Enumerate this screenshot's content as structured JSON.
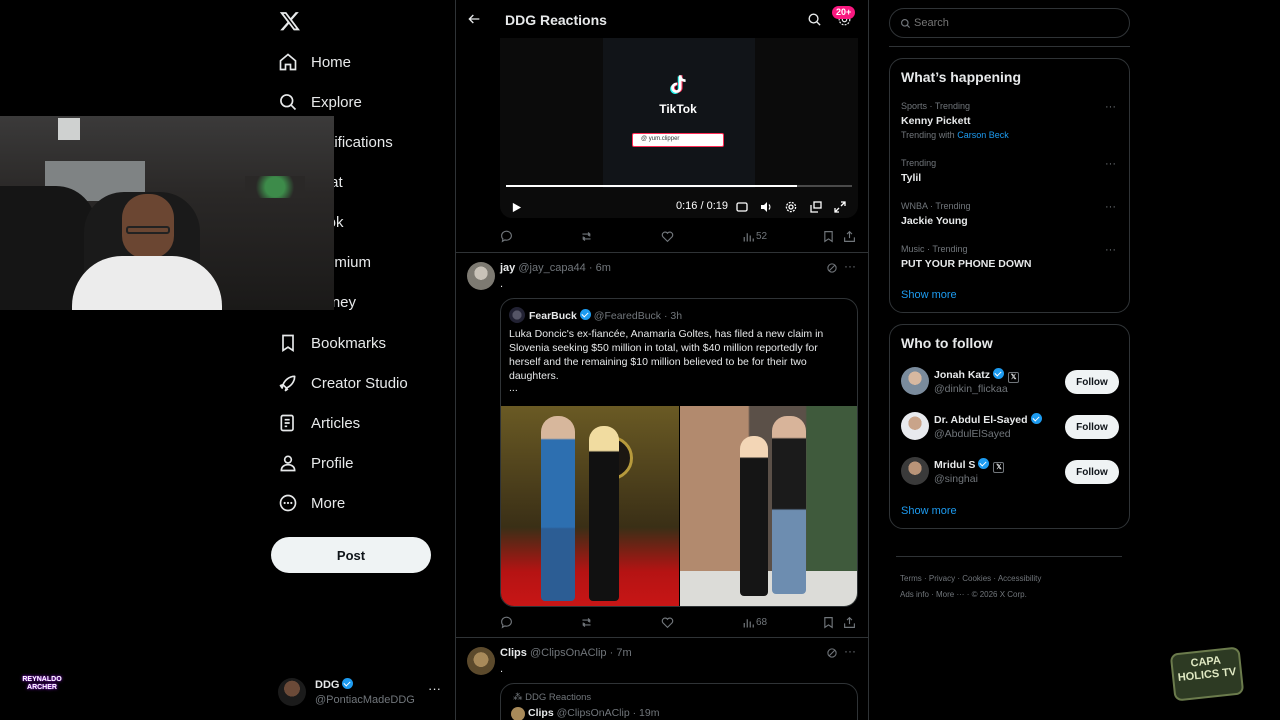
{
  "nav": {
    "items": [
      {
        "label": "Home",
        "icon": "home-icon"
      },
      {
        "label": "Explore",
        "icon": "search-icon"
      },
      {
        "label": "Notifications",
        "icon": "bell-icon"
      },
      {
        "label": "Chat",
        "icon": "mail-icon"
      },
      {
        "label": "Grok",
        "icon": "grok-icon"
      },
      {
        "label": "Premium",
        "icon": "x-logo-icon"
      },
      {
        "label": "Money",
        "icon": "money-icon"
      },
      {
        "label": "Bookmarks",
        "icon": "bookmark-icon"
      },
      {
        "label": "Creator Studio",
        "icon": "rocket-icon"
      },
      {
        "label": "Articles",
        "icon": "article-icon"
      },
      {
        "label": "Profile",
        "icon": "person-icon"
      },
      {
        "label": "More",
        "icon": "more-circle-icon"
      }
    ],
    "post_label": "Post",
    "account": {
      "name": "DDG",
      "handle": "@PontiacMadeDDG"
    }
  },
  "overlay": {
    "watermark_left": "REYNALDO ARCHER",
    "watermark_right": "CAPA HOLICS TV"
  },
  "header": {
    "title": "DDG Reactions",
    "badge": "20+"
  },
  "video": {
    "brand": "TikTok",
    "search_text": "@ yum.clipper",
    "time": "0:16 / 0:19",
    "progress": 0.84,
    "views": "52"
  },
  "tweet1": {
    "name": "jay",
    "handle": "@jay_capa44",
    "time": "6m",
    "text": ".",
    "quote": {
      "name": "FearBuck",
      "handle": "@FearedBuck",
      "time": "3h",
      "text": "Luka Doncic's ex-fiancée, Anamaria Goltes, has filed a new claim in Slovenia seeking $50 million in total, with $40 million reportedly for herself and the remaining $10 million believed to be for their two daughters.",
      "ellipsis": "..."
    },
    "views": "68"
  },
  "tweet2": {
    "name": "Clips",
    "handle": "@ClipsOnAClip",
    "time": "7m",
    "text": ".",
    "quote": {
      "community": "DDG Reactions",
      "name": "Clips",
      "handle": "@ClipsOnAClip",
      "time": "19m"
    }
  },
  "search": {
    "placeholder": "Search"
  },
  "trending": {
    "title": "What’s happening",
    "items": [
      {
        "context": "Sports · Trending",
        "topic": "Kenny Pickett",
        "with_label": "Trending with",
        "with_link": "Carson Beck"
      },
      {
        "context": "Trending",
        "topic": "Tylil"
      },
      {
        "context": "WNBA · Trending",
        "topic": "Jackie Young"
      },
      {
        "context": "Music · Trending",
        "topic": "PUT YOUR PHONE DOWN"
      }
    ],
    "show_more": "Show more"
  },
  "who_to_follow": {
    "title": "Who to follow",
    "users": [
      {
        "name": "Jonah Katz",
        "handle": "@dinkin_flickaa"
      },
      {
        "name": "Dr. Abdul El-Sayed",
        "handle": "@AbdulElSayed"
      },
      {
        "name": "Mridul S",
        "handle": "@singhai"
      }
    ],
    "follow_label": "Follow",
    "show_more": "Show more"
  },
  "footer": {
    "links": [
      "Terms",
      "Privacy",
      "Cookies",
      "Accessibility",
      "Ads info",
      "More ···"
    ],
    "copyright": "© 2026 X Corp."
  },
  "colors": {
    "accent": "#1d9bf0",
    "badge": "#f91880",
    "border": "#2f3336",
    "muted": "#71767b"
  }
}
